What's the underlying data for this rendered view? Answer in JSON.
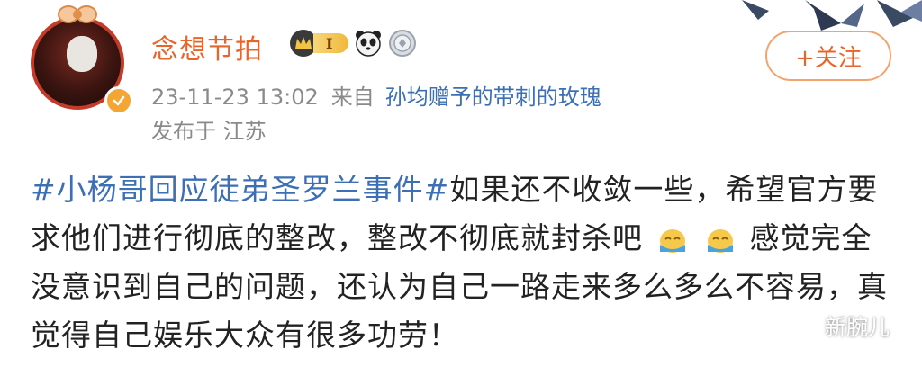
{
  "user": {
    "name": "念想节拍",
    "vip_level": "I",
    "follow_label": "+关注"
  },
  "post": {
    "timestamp": "23-11-23 13:02",
    "source_prefix": "来自",
    "source": "孙均赠予的带刺的玫瑰",
    "location": "发布于 江苏",
    "hashtag": "#小杨哥回应徒弟圣罗兰事件#",
    "text_part1": "如果还不收敛一些，希望官方要求他们进行彻底的整改，整改不彻底就封杀吧",
    "text_part2": "感觉完全没意识到自己的问题，还认为自己一路走来多么多么不容易，真觉得自己娱乐大众有很多功劳！"
  },
  "watermark": {
    "text": "新腕儿"
  },
  "colors": {
    "username": "#e8652a",
    "link": "#3d6fb5",
    "meta": "#8a8a8a",
    "follow_border": "#f2a46e"
  },
  "icons": [
    "avatar",
    "verified-badge-icon",
    "vip-crown-icon",
    "panda-badge-icon",
    "medal-badge-icon",
    "emoji-face-icon",
    "wechat-icon",
    "paper-crane-decoration"
  ]
}
